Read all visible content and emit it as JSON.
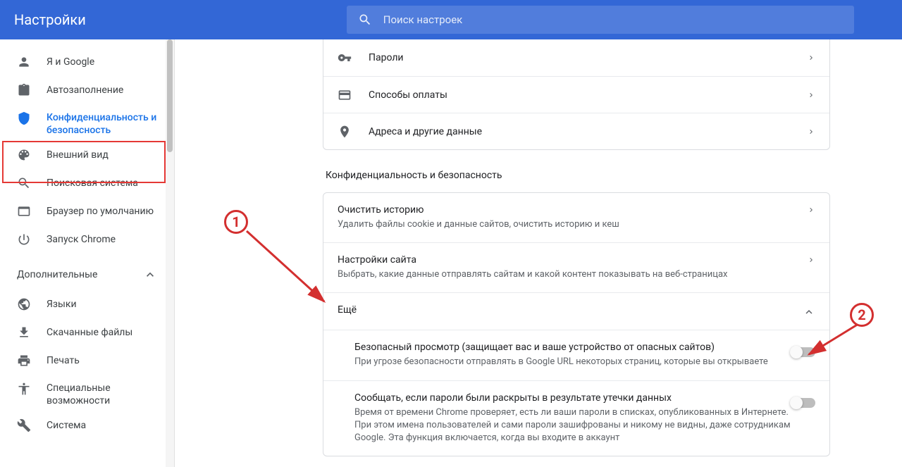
{
  "header": {
    "title": "Настройки",
    "search_placeholder": "Поиск настроек"
  },
  "sidebar": {
    "items": [
      {
        "label": "Я и Google"
      },
      {
        "label": "Автозаполнение"
      },
      {
        "label": "Конфиденциальность и безопасность"
      },
      {
        "label": "Внешний вид"
      },
      {
        "label": "Поисковая система"
      },
      {
        "label": "Браузер по умолчанию"
      },
      {
        "label": "Запуск Chrome"
      }
    ],
    "advanced_label": "Дополнительные",
    "advanced_items": [
      {
        "label": "Языки"
      },
      {
        "label": "Скачанные файлы"
      },
      {
        "label": "Печать"
      },
      {
        "label": "Специальные возможности"
      },
      {
        "label": "Система"
      }
    ]
  },
  "autofill_card": {
    "rows": [
      {
        "label": "Пароли"
      },
      {
        "label": "Способы оплаты"
      },
      {
        "label": "Адреса и другие данные"
      }
    ]
  },
  "section_title": "Конфиденциальность и безопасность",
  "privacy_card": {
    "clear": {
      "title": "Очистить историю",
      "desc": "Удалить файлы cookie и данные сайтов, очистить историю и кеш"
    },
    "site": {
      "title": "Настройки сайта",
      "desc": "Выбрать, какие данные отправлять сайтам и какой контент показывать на веб-страницах"
    },
    "more": {
      "title": "Ещё"
    },
    "safe": {
      "title": "Безопасный просмотр (защищает вас и ваше устройство от опасных сайтов)",
      "desc": "При угрозе безопасности отправлять в Google URL некоторых страниц, которые вы открываете"
    },
    "pwd": {
      "title": "Сообщать, если пароли были раскрыты в результате утечки данных",
      "desc": "Время от времени Chrome проверяет, есть ли ваши пароли в списках, опубликованных в Интернете. При этом имена пользователей и сами пароли зашифрованы и никому не видны, даже сотрудникам Google. Эта функция включается, когда вы входите в аккаунт"
    }
  },
  "annotations": {
    "m1": "1",
    "m2": "2"
  }
}
